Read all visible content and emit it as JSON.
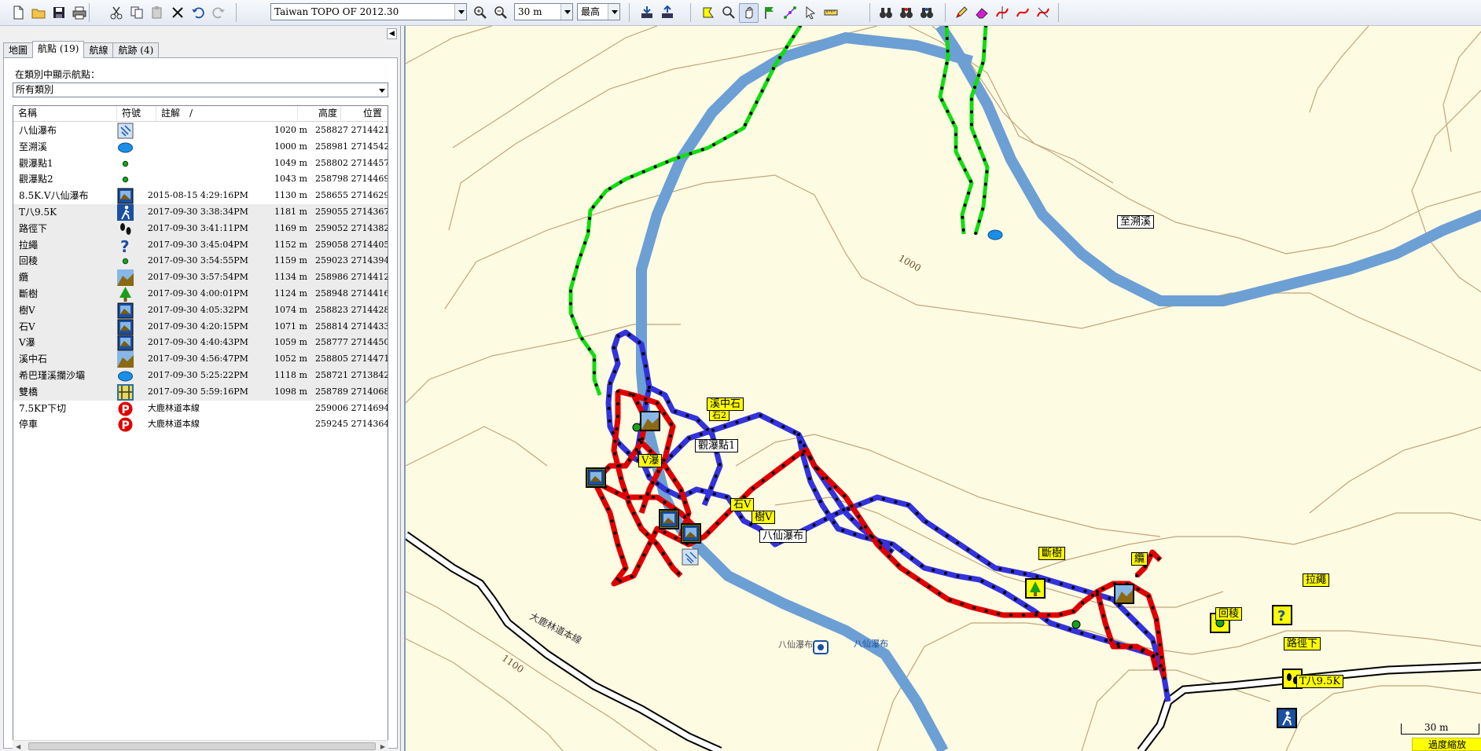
{
  "toolbar": {
    "map_product": "Taiwan TOPO OF 2012.30",
    "zoom_level": "30 m",
    "detail_level": "最高",
    "buttons": [
      {
        "name": "new-icon"
      },
      {
        "name": "open-folder-icon"
      },
      {
        "name": "save-icon"
      },
      {
        "name": "print-icon"
      },
      {
        "name": "cut-icon"
      },
      {
        "name": "copy-icon"
      },
      {
        "name": "paste-icon"
      },
      {
        "name": "delete-icon"
      },
      {
        "name": "undo-icon"
      },
      {
        "name": "redo-icon"
      }
    ]
  },
  "panel": {
    "tabs": [
      "地圖",
      "航點 (19)",
      "航線",
      "航跡 (4)"
    ],
    "active_tab": 1,
    "category_label": "在類別中顯示航點：",
    "category_value": "所有類別",
    "columns": [
      "名稱",
      "符號",
      "註解",
      "/",
      "高度",
      "位置"
    ]
  },
  "waypoints": [
    {
      "name": "八仙瀑布",
      "symbol": "waterfall-icon",
      "note": "",
      "alt": "1020 m",
      "pos": "258827 2714421",
      "sel": false
    },
    {
      "name": "至溯溪",
      "symbol": "water-blob-icon",
      "note": "",
      "alt": "1000 m",
      "pos": "258981 2714542",
      "sel": false
    },
    {
      "name": "觀瀑點1",
      "symbol": "green-dot-icon",
      "note": "",
      "alt": "1049 m",
      "pos": "258802 2714457",
      "sel": false
    },
    {
      "name": "觀瀑點2",
      "symbol": "green-dot-icon",
      "note": "",
      "alt": "1043 m",
      "pos": "258798 2714469",
      "sel": false
    },
    {
      "name": "8.5K.V八仙瀑布",
      "symbol": "scenic-photo-icon",
      "note": "2015-08-15 4:29:16PM",
      "alt": "1130 m",
      "pos": "258655 2714629",
      "sel": false
    },
    {
      "name": "T八9.5K",
      "symbol": "hiker-icon",
      "note": "2017-09-30 3:38:34PM",
      "alt": "1181 m",
      "pos": "259055 2714367",
      "sel": true
    },
    {
      "name": "路徑下",
      "symbol": "footprints-icon",
      "note": "2017-09-30 3:41:11PM",
      "alt": "1169 m",
      "pos": "259052 2714382",
      "sel": true
    },
    {
      "name": "拉繩",
      "symbol": "question-icon",
      "note": "2017-09-30 3:45:04PM",
      "alt": "1152 m",
      "pos": "259058 2714405",
      "sel": true
    },
    {
      "name": "回稜",
      "symbol": "green-dot-icon",
      "note": "2017-09-30 3:54:55PM",
      "alt": "1159 m",
      "pos": "259023 2714394",
      "sel": true
    },
    {
      "name": "纜",
      "symbol": "summit-icon",
      "note": "2017-09-30 3:57:54PM",
      "alt": "1134 m",
      "pos": "258986 2714412",
      "sel": true
    },
    {
      "name": "斷樹",
      "symbol": "tree-icon",
      "note": "2017-09-30 4:00:01PM",
      "alt": "1124 m",
      "pos": "258948 2714416",
      "sel": true
    },
    {
      "name": "樹V",
      "symbol": "scenic-photo-icon",
      "note": "2017-09-30 4:05:32PM",
      "alt": "1074 m",
      "pos": "258823 2714428",
      "sel": true
    },
    {
      "name": "石V",
      "symbol": "scenic-photo-icon",
      "note": "2017-09-30 4:20:15PM",
      "alt": "1071 m",
      "pos": "258814 2714433",
      "sel": true
    },
    {
      "name": "V瀑",
      "symbol": "scenic-photo-icon",
      "note": "2017-09-30 4:40:43PM",
      "alt": "1059 m",
      "pos": "258777 2714450",
      "sel": true
    },
    {
      "name": "溪中石",
      "symbol": "summit-icon",
      "note": "2017-09-30 4:56:47PM",
      "alt": "1052 m",
      "pos": "258805 2714471",
      "sel": true
    },
    {
      "name": "希巴瑾溪攔沙壩",
      "symbol": "water-blob-icon",
      "note": "2017-09-30 5:25:22PM",
      "alt": "1118 m",
      "pos": "258721 2713842",
      "sel": true
    },
    {
      "name": "雙橋",
      "symbol": "bridge-icon",
      "note": "2017-09-30 5:59:16PM",
      "alt": "1098 m",
      "pos": "258789 2714068",
      "sel": true
    },
    {
      "name": "7.5KP下切",
      "symbol": "parking-icon",
      "note": "大鹿林道本線",
      "alt": "",
      "pos": "259006 2714694",
      "sel": false
    },
    {
      "name": "停車",
      "symbol": "parking-icon",
      "note": "大鹿林道本線",
      "alt": "",
      "pos": "259245 2714364",
      "sel": false
    }
  ],
  "map": {
    "contour_labels": [
      "1000",
      "1100"
    ],
    "road_label": "大鹿林道本線",
    "poi_text_left": "八仙瀑布",
    "poi_text_right": "八仙瀑布",
    "scale_label": "30 m",
    "zoom_status": "過度縮放",
    "labels": [
      {
        "key": "溪中石",
        "text": "溪中石",
        "white": false
      },
      {
        "key": "石2",
        "text": "石2",
        "white": false
      },
      {
        "key": "觀瀑點1",
        "text": "觀瀑點1",
        "white": true
      },
      {
        "key": "V瀑",
        "text": "V瀑",
        "white": false
      },
      {
        "key": "石V",
        "text": "石V",
        "white": false
      },
      {
        "key": "樹V",
        "text": "樹V",
        "white": false
      },
      {
        "key": "八仙瀑布",
        "text": "八仙瀑布",
        "white": true
      },
      {
        "key": "至溯溪",
        "text": "至溯溪",
        "white": true
      },
      {
        "key": "斷樹",
        "text": "斷樹",
        "white": false
      },
      {
        "key": "纜",
        "text": "纜",
        "white": false
      },
      {
        "key": "回稜",
        "text": "回稜",
        "white": false
      },
      {
        "key": "拉繩",
        "text": "拉繩",
        "white": false
      },
      {
        "key": "路徑下",
        "text": "路徑下",
        "white": false
      },
      {
        "key": "T八9.5K",
        "text": "T八9.5K",
        "white": false
      }
    ]
  },
  "colors": {
    "track_blue": "#3333dd",
    "track_red": "#e00000",
    "track_green": "#11dd11",
    "river": "#6c9fd4",
    "contour": "#c2a57c",
    "map_bg": "#fefbe3",
    "waypoint_yellow": "#ffff00"
  }
}
